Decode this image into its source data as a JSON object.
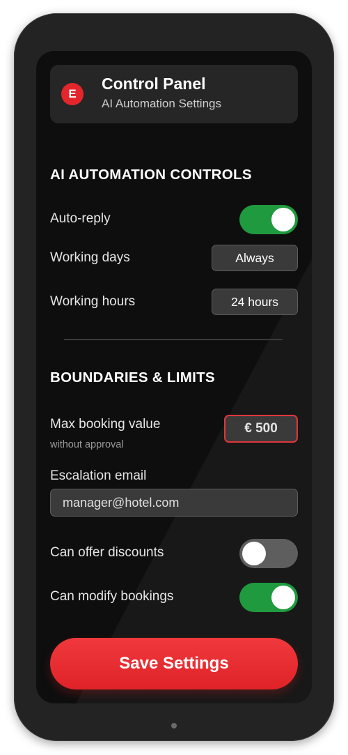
{
  "header": {
    "logo_letter": "E",
    "title": "Control Panel",
    "subtitle": "AI Automation Settings"
  },
  "automation": {
    "section_title": "AI AUTOMATION CONTROLS",
    "auto_reply": {
      "label": "Auto-reply",
      "enabled": true
    },
    "working_days": {
      "label": "Working days",
      "value": "Always"
    },
    "working_hours": {
      "label": "Working hours",
      "value": "24 hours"
    }
  },
  "limits": {
    "section_title": "BOUNDARIES & LIMITS",
    "max_booking": {
      "label": "Max booking value",
      "sublabel": "without approval",
      "value": "€ 500"
    },
    "escalation_email": {
      "label": "Escalation email",
      "value": "manager@hotel.com"
    },
    "offer_discounts": {
      "label": "Can offer discounts",
      "enabled": false
    },
    "modify_bookings": {
      "label": "Can modify bookings",
      "enabled": true
    }
  },
  "save_label": "Save Settings",
  "colors": {
    "accent_red": "#e3262b",
    "toggle_on": "#1f9a3e",
    "toggle_off": "#5e5e5e",
    "screen_bg": "#0e0e0e"
  }
}
